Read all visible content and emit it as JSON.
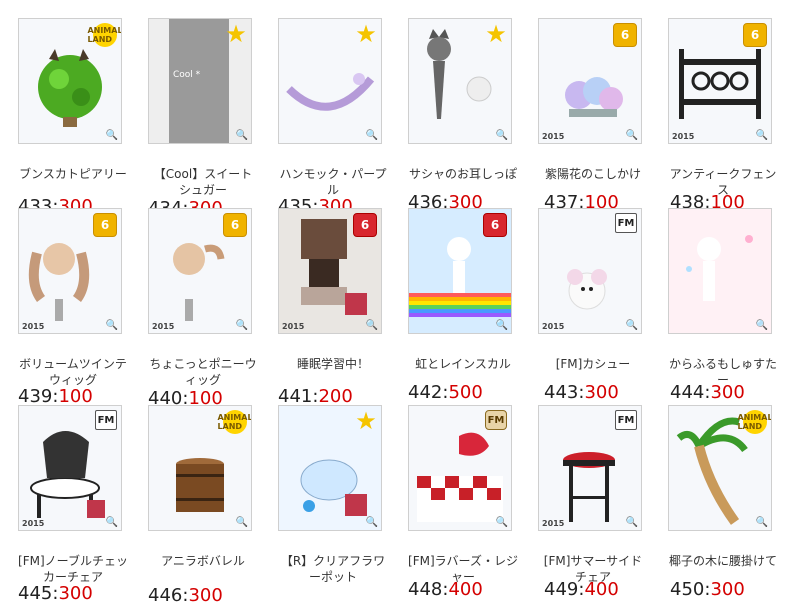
{
  "items": [
    {
      "name": "ブンスカトピアリー",
      "num": "433",
      "price": "300",
      "badge": "ANIMAL LAND",
      "badge_type": "animal",
      "year": "",
      "scene": "bush"
    },
    {
      "name": "【Cool】スイートシュガー",
      "num": "434",
      "price": "300",
      "badge": "★",
      "badge_type": "star",
      "year": "",
      "scene": "sugar"
    },
    {
      "name": "ハンモック・パープル",
      "num": "435",
      "price": "300",
      "badge": "★",
      "badge_type": "star",
      "year": "",
      "scene": "hammock"
    },
    {
      "name": "サシャのお耳しっぽ",
      "num": "436",
      "price": "300",
      "badge": "★",
      "badge_type": "star",
      "year": "",
      "scene": "ears"
    },
    {
      "name": "紫陽花のこしかけ",
      "num": "437",
      "price": "100",
      "badge": "6",
      "badge_type": "b6",
      "year": "2015",
      "scene": "hydrangea"
    },
    {
      "name": "アンティークフェンス",
      "num": "438",
      "price": "100",
      "badge": "6",
      "badge_type": "b6",
      "year": "2015",
      "scene": "fence"
    },
    {
      "name": "ボリュームツインテウィッグ",
      "num": "439",
      "price": "100",
      "badge": "6",
      "badge_type": "b6",
      "year": "2015",
      "scene": "wig1"
    },
    {
      "name": "ちょこっとポニーウィッグ",
      "num": "440",
      "price": "100",
      "badge": "6",
      "badge_type": "b6",
      "year": "2015",
      "scene": "wig2"
    },
    {
      "name": "睡眠学習中！",
      "num": "441",
      "price": "200",
      "badge": "6",
      "badge_type": "b6r",
      "year": "2015",
      "scene": "sleep"
    },
    {
      "name": "虹とレインスカル",
      "num": "442",
      "price": "500",
      "badge": "6",
      "badge_type": "b6r",
      "year": "",
      "scene": "rainbow"
    },
    {
      "name": "[FM]カシュー",
      "num": "443",
      "price": "300",
      "badge": "FM",
      "badge_type": "fm",
      "year": "2015",
      "scene": "mouse"
    },
    {
      "name": "からふるもしゅすたー",
      "num": "444",
      "price": "300",
      "badge": "",
      "badge_type": "none",
      "year": "",
      "scene": "pink"
    },
    {
      "name": "[FM]ノーブルチェッカーチェア",
      "num": "445",
      "price": "300",
      "badge": "FM",
      "badge_type": "fm",
      "year": "2015",
      "scene": "chair"
    },
    {
      "name": "アニラボバレル",
      "num": "446",
      "price": "300",
      "badge": "ANIMAL LAND",
      "badge_type": "animal",
      "year": "",
      "scene": "barrel"
    },
    {
      "name": "【R】クリアフラワーポット",
      "num": "",
      "price": "",
      "badge": "★",
      "badge_type": "star",
      "year": "",
      "scene": "teapot"
    },
    {
      "name": "[FM]ラバーズ・レジャー",
      "num": "448",
      "price": "400",
      "badge": "FM",
      "badge_type": "fmvip",
      "year": "",
      "scene": "picnic"
    },
    {
      "name": "[FM]サマーサイドチェア",
      "num": "449",
      "price": "400",
      "badge": "FM",
      "badge_type": "fm",
      "year": "2015",
      "scene": "stool"
    },
    {
      "name": "椰子の木に腰掛けて",
      "num": "450",
      "price": "300",
      "badge": "ANIMAL LAND",
      "badge_type": "animal",
      "year": "",
      "scene": "palm"
    }
  ],
  "zoom_icon": "magnify-plus-icon",
  "colors": {
    "price": "#d40000",
    "border": "#cfcfcf"
  }
}
